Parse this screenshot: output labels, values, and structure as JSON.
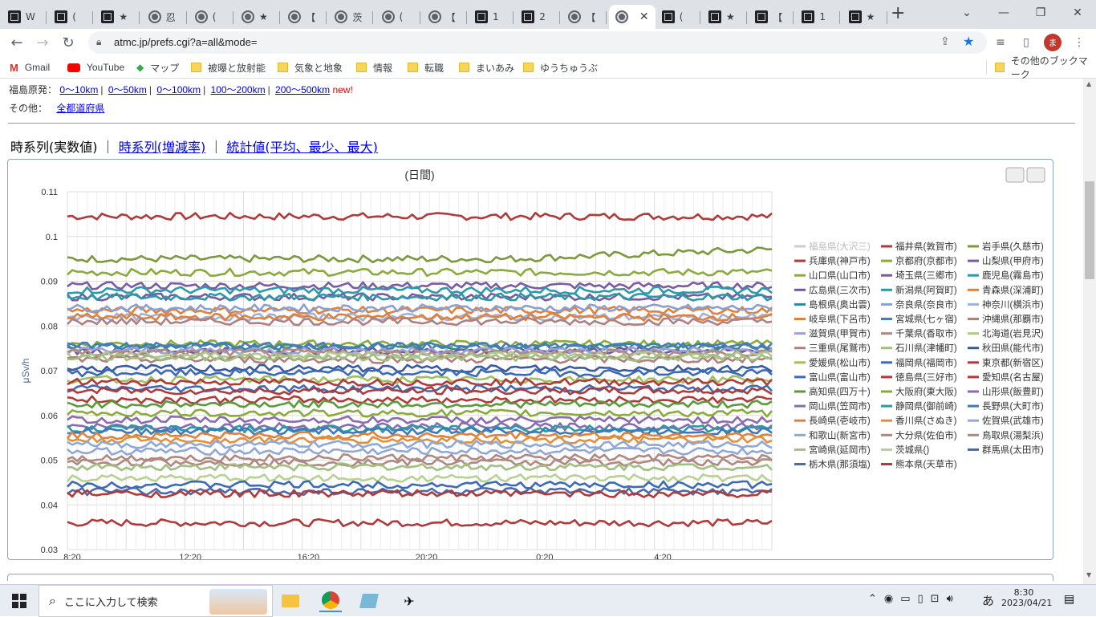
{
  "browser": {
    "tabs": [
      {
        "title": "W",
        "icon": "doc-icon"
      },
      {
        "title": "(",
        "icon": "doc-icon"
      },
      {
        "title": "★",
        "icon": "doc-icon"
      },
      {
        "title": "忍",
        "icon": "globe-icon"
      },
      {
        "title": "(",
        "icon": "globe-icon"
      },
      {
        "title": "★",
        "icon": "globe-icon"
      },
      {
        "title": "【",
        "icon": "globe-icon"
      },
      {
        "title": "茨",
        "icon": "globe-icon"
      },
      {
        "title": "(",
        "icon": "globe-icon"
      },
      {
        "title": "【",
        "icon": "globe-icon"
      },
      {
        "title": "1",
        "icon": "doc-icon"
      },
      {
        "title": "2",
        "icon": "doc-icon"
      },
      {
        "title": "【",
        "icon": "globe-icon"
      },
      {
        "title": "",
        "icon": "globe-icon",
        "active": true
      },
      {
        "title": "(",
        "icon": "doc-icon"
      },
      {
        "title": "★",
        "icon": "doc-icon"
      },
      {
        "title": "【",
        "icon": "doc-icon"
      },
      {
        "title": "1",
        "icon": "doc-icon"
      },
      {
        "title": "★",
        "icon": "doc-icon"
      }
    ],
    "url": "atmc.jp/prefs.cgi?a=all&mode=",
    "profile_initial": "ま",
    "bookmarks": [
      {
        "label": "Gmail",
        "icon": "gmail-icon"
      },
      {
        "label": "YouTube",
        "icon": "youtube-icon"
      },
      {
        "label": "マップ",
        "icon": "maps-icon"
      },
      {
        "label": "被曝と放射能",
        "icon": "folder-icon"
      },
      {
        "label": "気象と地象",
        "icon": "folder-icon"
      },
      {
        "label": "情報",
        "icon": "folder-icon"
      },
      {
        "label": "転職",
        "icon": "folder-icon"
      },
      {
        "label": "まいあみ",
        "icon": "folder-icon"
      },
      {
        "label": "ゆうちゅうぶ",
        "icon": "folder-icon"
      }
    ],
    "other_bookmarks": "その他のブックマーク"
  },
  "page": {
    "fukushima_label": "福島原発：",
    "fukushima_links": [
      "0〜10km",
      "0〜50km",
      "0〜100km",
      "100〜200km",
      "200〜500km"
    ],
    "new_badge": "new!",
    "other_label": "その他：",
    "other_link": "全都道府県",
    "chart_tabs": {
      "current": "時系列(実数値)",
      "sep": "｜",
      "link1": "時系列(増減率)",
      "link2": "統計値(平均、最少、最大)"
    }
  },
  "chart_data": {
    "type": "line",
    "title": "(日間)",
    "ylabel": "μSv/h",
    "ylim": [
      0.03,
      0.11
    ],
    "yticks": [
      "0.03",
      "0.04",
      "0.05",
      "0.06",
      "0.07",
      "0.08",
      "0.09",
      "0.1",
      "0.11"
    ],
    "xticks": [
      "8:20",
      "12:20",
      "16:20",
      "20:20",
      "0:20",
      "4:20"
    ],
    "grid": true,
    "legend_position": "right",
    "series": [
      {
        "name": "福島県(大沢三)",
        "color": "#c0c0c0",
        "level": null,
        "hidden": true
      },
      {
        "name": "福井県(敦賀市)",
        "color": "#b03a3a",
        "level": 0.1045
      },
      {
        "name": "岩手県(久慈市)",
        "color": "#7a9a3a",
        "level": 0.095
      },
      {
        "name": "兵庫県(神戸市)",
        "color": "#b03a3a",
        "level": 0.036
      },
      {
        "name": "京都府(京都市)",
        "color": "#8aab3a",
        "level": 0.092
      },
      {
        "name": "山梨県(甲府市)",
        "color": "#7a5aa0",
        "level": 0.089
      },
      {
        "name": "山口県(山口市)",
        "color": "#8aab3a",
        "level": 0.076
      },
      {
        "name": "埼玉県(三郷市)",
        "color": "#7a5aa0",
        "level": 0.0865
      },
      {
        "name": "鹿児島(霧島市)",
        "color": "#2a9aaa",
        "level": 0.088
      },
      {
        "name": "広島県(三次市)",
        "color": "#6a5aa0",
        "level": 0.0745
      },
      {
        "name": "新潟県(阿賀町)",
        "color": "#2a9aaa",
        "level": 0.0865
      },
      {
        "name": "青森県(深浦町)",
        "color": "#e0803a",
        "level": 0.0835
      },
      {
        "name": "島根県(奥出雲)",
        "color": "#2a8aa0",
        "level": 0.0755
      },
      {
        "name": "奈良県(奈良市)",
        "color": "#8aa0d0",
        "level": 0.084
      },
      {
        "name": "神奈川(横浜市)",
        "color": "#a0b0d8",
        "level": 0.082
      },
      {
        "name": "岐阜県(下呂市)",
        "color": "#e0803a",
        "level": 0.082
      },
      {
        "name": "宮城県(七ヶ宿)",
        "color": "#4a7ab8",
        "level": 0.0755
      },
      {
        "name": "沖縄県(那覇市)",
        "color": "#b08080",
        "level": 0.081
      },
      {
        "name": "滋賀県(甲賀市)",
        "color": "#a0a0d8",
        "level": 0.0745
      },
      {
        "name": "千葉県(香取市)",
        "color": "#b08a80",
        "level": 0.074
      },
      {
        "name": "北海道(岩見沢)",
        "color": "#b0c890",
        "level": 0.0735
      },
      {
        "name": "三重県(尾鷲市)",
        "color": "#b08080",
        "level": 0.0725
      },
      {
        "name": "石川県(津幡町)",
        "color": "#a0c080",
        "level": 0.073
      },
      {
        "name": "秋田県(能代市)",
        "color": "#3a5aa0",
        "level": 0.0705
      },
      {
        "name": "愛媛県(松山市)",
        "color": "#a0c060",
        "level": 0.068
      },
      {
        "name": "福岡県(福岡市)",
        "color": "#3a6ab8",
        "level": 0.0695
      },
      {
        "name": "東京都(新宿区)",
        "color": "#b03a3a",
        "level": 0.0675
      },
      {
        "name": "富山県(富山市)",
        "color": "#3a6ab8",
        "level": 0.066
      },
      {
        "name": "徳島県(三好市)",
        "color": "#b03a3a",
        "level": 0.0655
      },
      {
        "name": "愛知県(名古屋)",
        "color": "#b03a3a",
        "level": 0.0635
      },
      {
        "name": "高知県(四万十)",
        "color": "#5a9a3a",
        "level": 0.0625
      },
      {
        "name": "大阪府(東大阪)",
        "color": "#8aab3a",
        "level": 0.0605
      },
      {
        "name": "山形県(飯豊町)",
        "color": "#8a6ab0",
        "level": 0.059
      },
      {
        "name": "岡山県(笠岡市)",
        "color": "#8a6ab0",
        "level": 0.0575
      },
      {
        "name": "静岡県(御前崎)",
        "color": "#2a9aaa",
        "level": 0.057
      },
      {
        "name": "長野県(大町市)",
        "color": "#3a7ab8",
        "level": 0.0565
      },
      {
        "name": "長崎県(壱岐市)",
        "color": "#e0803a",
        "level": 0.0555
      },
      {
        "name": "香川県(さぬき)",
        "color": "#e0903a",
        "level": 0.0545
      },
      {
        "name": "佐賀県(武雄市)",
        "color": "#90a8d8",
        "level": 0.0535
      },
      {
        "name": "和歌山(新宮市)",
        "color": "#90a8d8",
        "level": 0.052
      },
      {
        "name": "大分県(佐伯市)",
        "color": "#b08880",
        "level": 0.0505
      },
      {
        "name": "鳥取県(湯梨浜)",
        "color": "#b08880",
        "level": 0.0495
      },
      {
        "name": "宮崎県(延岡市)",
        "color": "#a0c080",
        "level": 0.0485
      },
      {
        "name": "茨城県()",
        "color": "#b8d090",
        "level": 0.046
      },
      {
        "name": "群馬県(太田市)",
        "color": "#3a6ab8",
        "level": 0.0445
      },
      {
        "name": "栃木県(那須塩)",
        "color": "#4a6ab0",
        "level": 0.043
      },
      {
        "name": "熊本県(天草市)",
        "color": "#b03a3a",
        "level": 0.0425
      }
    ]
  },
  "taskbar": {
    "search_placeholder": "ここに入力して検索",
    "ime": "あ",
    "time": "8:30",
    "date": "2023/04/21"
  }
}
